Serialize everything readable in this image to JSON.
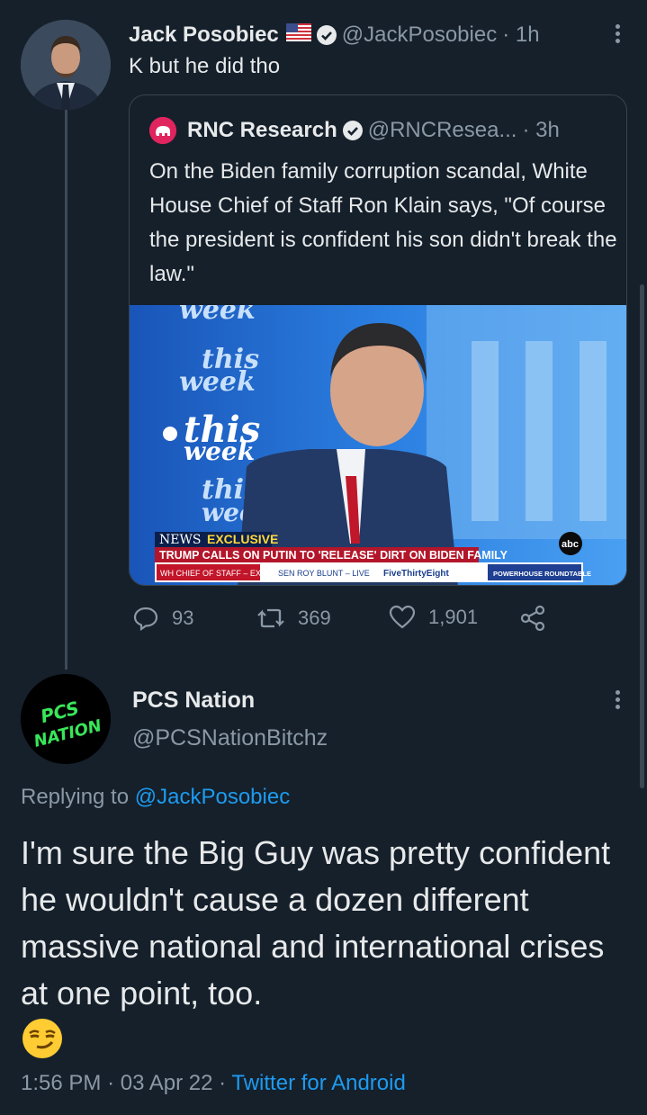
{
  "main_tweet": {
    "name": "Jack Posobiec",
    "flag_icon": "us-flag-icon",
    "handle": "@JackPosobiec",
    "time": "· 1h",
    "text": "K but he did tho"
  },
  "quote": {
    "name": "RNC Research",
    "handle": "@RNCResea...",
    "time": "· 3h",
    "text": "On the Biden family corruption scandal, White House Chief of Staff Ron Klain says, \"Of course the president is confident his son didn't break the law.\"",
    "media": {
      "bg_words": [
        "week",
        "this",
        "week",
        "this",
        "week",
        "this",
        "wee"
      ],
      "news_logo": "NEWS",
      "exclusive": "EXCLUSIVE",
      "headline": "TRUMP CALLS ON PUTIN TO 'RELEASE' DIRT ON BIDEN FAMILY",
      "ticker": [
        "WH CHIEF OF STAFF – EXCLUSIVE",
        "SEN ROY BLUNT – LIVE",
        "FiveThirtyEight",
        "POWERHOUSE ROUNDTABLE"
      ],
      "abc": "abc"
    }
  },
  "actions": {
    "replies": "93",
    "retweets": "369",
    "likes": "1,901"
  },
  "reply": {
    "name": "PCS Nation",
    "handle": "@PCSNationBitchz",
    "avatar_text_1": "PCS",
    "avatar_text_2": "NATION",
    "replying_prefix": "Replying to",
    "replying_to": "@JackPosobiec",
    "text": "I'm sure the Big Guy was pretty confident he wouldn't cause a dozen different massive national and international crises at one point, too.",
    "emoji_icon": "smirk-emoji-icon",
    "time": "1:56 PM",
    "sep1": "·",
    "date": "03 Apr 22",
    "sep2": "·",
    "source": "Twitter for Android"
  },
  "colors": {
    "background": "#15202b",
    "accent": "#1d9bf0",
    "muted": "#8b98a5"
  }
}
